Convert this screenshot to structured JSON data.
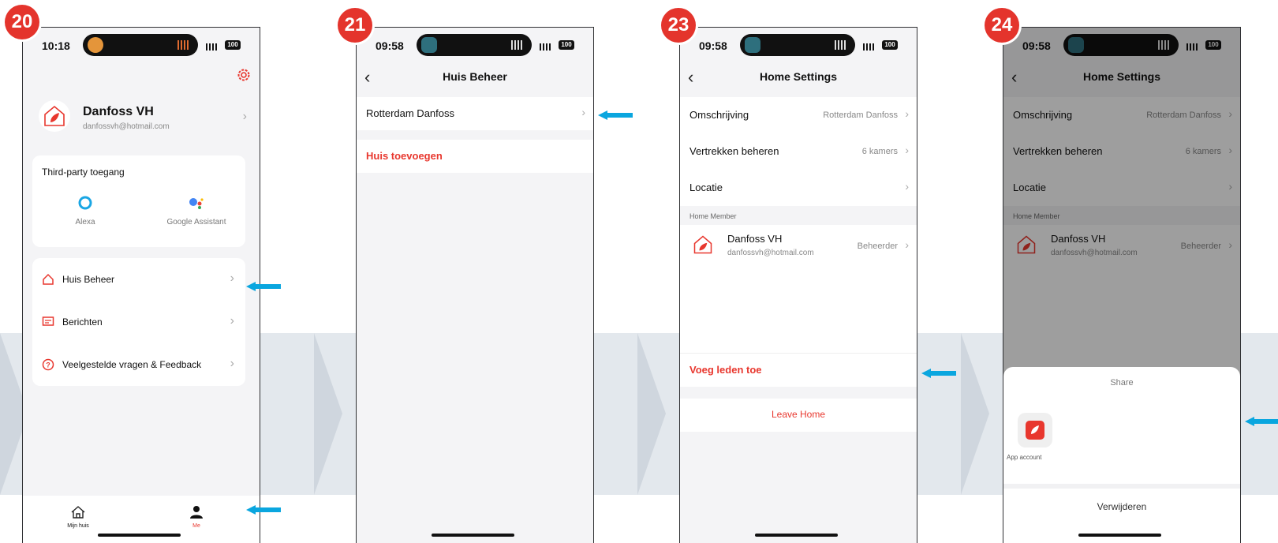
{
  "steps": [
    "20",
    "21",
    "23",
    "24"
  ],
  "screen20": {
    "time": "10:18",
    "battery": "100",
    "profile_name": "Danfoss VH",
    "profile_email": "danfossvh@hotmail.com",
    "third_party_title": "Third-party toegang",
    "alexa_label": "Alexa",
    "google_label": "Google Assistant",
    "menu": [
      {
        "label": "Huis Beheer",
        "icon": "house-outline-icon"
      },
      {
        "label": "Berichten",
        "icon": "message-icon"
      },
      {
        "label": "Veelgestelde vragen & Feedback",
        "icon": "question-circle-icon"
      }
    ],
    "tab_home": "Mijn huis",
    "tab_me": "Me"
  },
  "screen21": {
    "time": "09:58",
    "battery": "100",
    "title": "Huis Beheer",
    "home_item": "Rotterdam Danfoss",
    "add_home": "Huis toevoegen"
  },
  "screen23": {
    "time": "09:58",
    "battery": "100",
    "title": "Home Settings",
    "rows": [
      {
        "label": "Omschrijving",
        "value": "Rotterdam Danfoss"
      },
      {
        "label": "Vertrekken beheren",
        "value": "6 kamers"
      },
      {
        "label": "Locatie",
        "value": ""
      }
    ],
    "member_section": "Home Member",
    "member_name": "Danfoss VH",
    "member_email": "danfossvh@hotmail.com",
    "member_role": "Beheerder",
    "add_members": "Voeg leden toe",
    "leave_home": "Leave Home"
  },
  "screen24": {
    "time": "09:58",
    "battery": "100",
    "title": "Home Settings",
    "rows": [
      {
        "label": "Omschrijving",
        "value": "Rotterdam Danfoss"
      },
      {
        "label": "Vertrekken beheren",
        "value": "6 kamers"
      },
      {
        "label": "Locatie",
        "value": ""
      }
    ],
    "member_section": "Home Member",
    "member_name": "Danfoss VH",
    "member_email": "danfossvh@hotmail.com",
    "member_role": "Beheerder",
    "share_title": "Share",
    "app_account": "App account",
    "remove": "Verwijderen"
  },
  "colors": {
    "accent": "#e8372e",
    "arrow": "#0aa6df",
    "badge": "#e4342c"
  }
}
